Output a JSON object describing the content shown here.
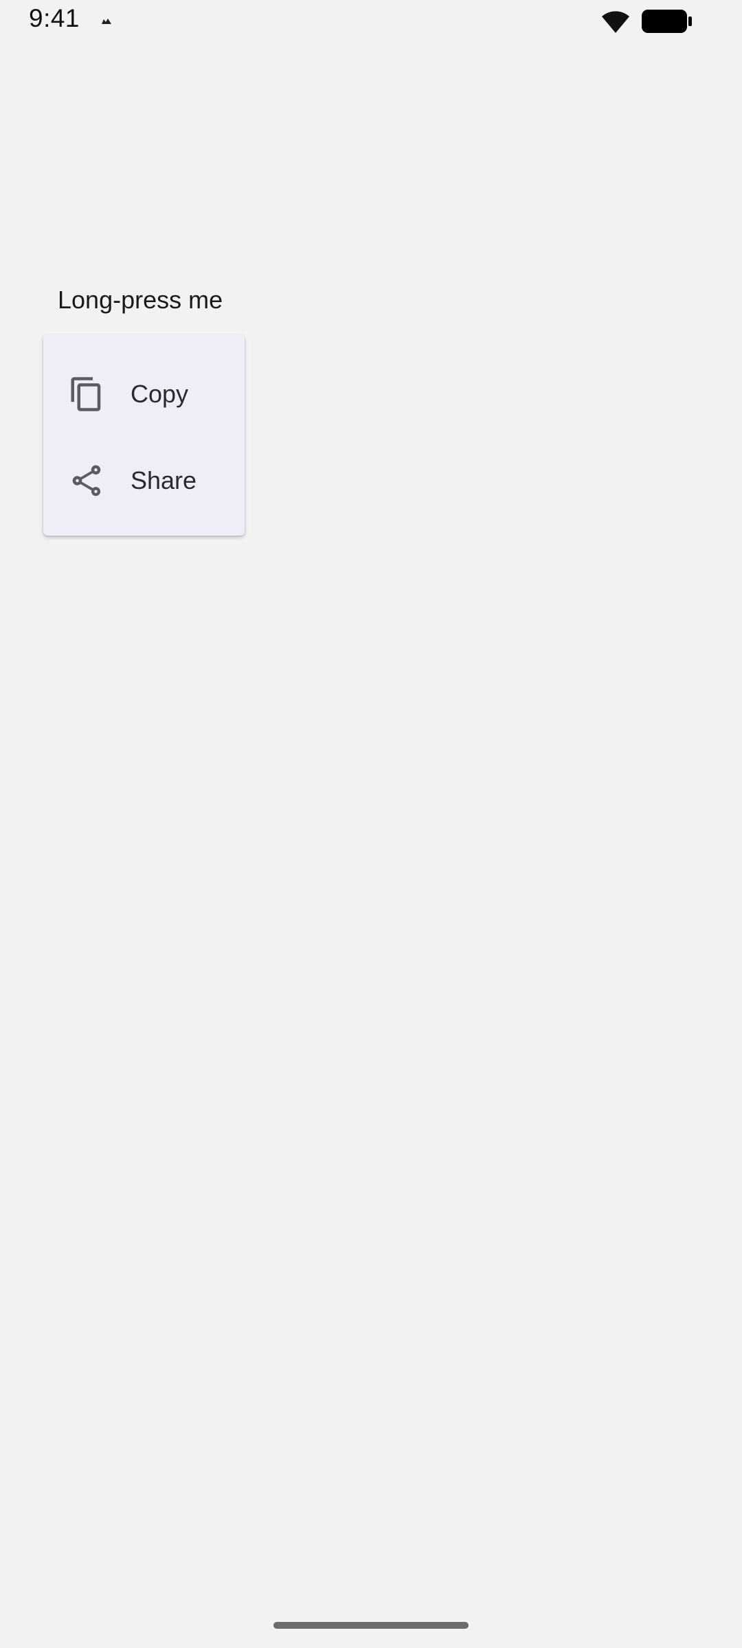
{
  "status_bar": {
    "time": "9:41",
    "icons": [
      "notification-icon",
      "wifi-icon",
      "battery-icon"
    ]
  },
  "main": {
    "long_press_text": "Long-press me"
  },
  "context_menu": {
    "items": [
      {
        "label": "Copy",
        "icon": "copy-icon"
      },
      {
        "label": "Share",
        "icon": "share-icon"
      }
    ]
  },
  "colors": {
    "background": "#f2f2f2",
    "menu_background": "#efedf6",
    "menu_text": "#2a2930",
    "icon": "#5c5a63"
  }
}
